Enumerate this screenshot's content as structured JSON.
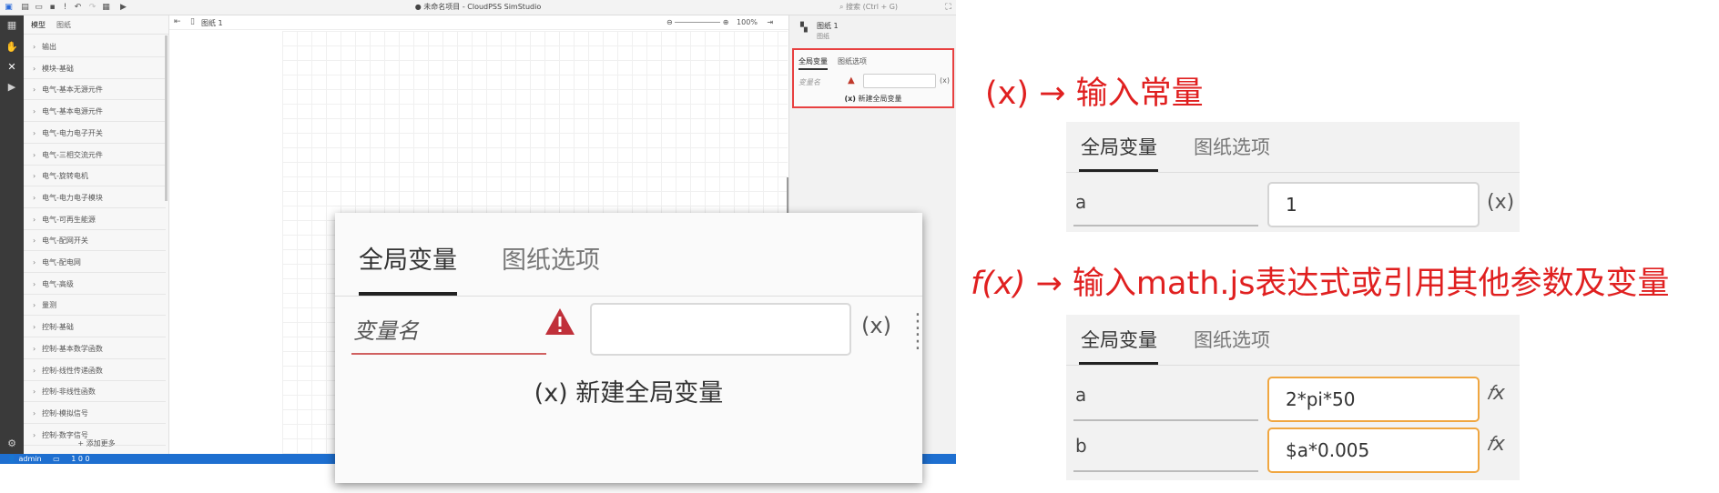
{
  "app": {
    "title": "● 未命名项目 - CloudPSS SimStudio",
    "search_placeholder": "搜索 (Ctrl + G)",
    "toolbar_icons": [
      "app-icon",
      "new-file-icon",
      "open-icon",
      "save-icon",
      "info-icon",
      "undo-icon",
      "redo-icon",
      "export-icon",
      "run-icon"
    ]
  },
  "library": {
    "tabs": [
      "模型",
      "图纸"
    ],
    "items": [
      "输出",
      "模块-基础",
      "电气-基本无源元件",
      "电气-基本电源元件",
      "电气-电力电子开关",
      "电气-三相交流元件",
      "电气-旋转电机",
      "电气-电力电子模块",
      "电气-可再生能源",
      "电气-配网开关",
      "电气-配电网",
      "电气-高级",
      "量测",
      "控制-基础",
      "控制-基本数学函数",
      "控制-线性传递函数",
      "控制-非线性函数",
      "控制-模拟信号",
      "控制-数字信号"
    ],
    "add_more": "添加更多"
  },
  "doc_tab": {
    "label": "图纸 1"
  },
  "zoom": {
    "value": "100%"
  },
  "props": {
    "header": "图纸 1",
    "subheader": "图纸",
    "tabs": [
      "全局变量",
      "图纸选项"
    ],
    "name_placeholder": "变量名",
    "x_symbol": "(x)",
    "new_global": "新建全局变量"
  },
  "status": {
    "user": "admin",
    "counts": "1  0  0"
  },
  "zoomed": {
    "tabs": [
      "全局变量",
      "图纸选项"
    ],
    "name_placeholder": "变量名",
    "x_symbol": "(x)",
    "new_global": "(x)  新建全局变量"
  },
  "annotations": {
    "const_label_a": "(x)",
    "const_label_b": " → 输入常量",
    "expr_label_a": "f(x)",
    "expr_label_b": " → 输入math.js表达式或引用其他参数及变量"
  },
  "card_const": {
    "tabs": [
      "全局变量",
      "图纸选项"
    ],
    "rows": [
      {
        "name": "a",
        "value": "1",
        "symbol": "(x)"
      }
    ]
  },
  "card_expr": {
    "tabs": [
      "全局变量",
      "图纸选项"
    ],
    "rows": [
      {
        "name": "a",
        "value": "2*pi*50",
        "symbol": "𝑓x"
      },
      {
        "name": "b",
        "value": "$a*0.005",
        "symbol": "𝑓x"
      }
    ]
  },
  "colors": {
    "accent_red": "#e02020",
    "status_blue": "#1e6fd0",
    "expr_border": "#f0a640"
  }
}
